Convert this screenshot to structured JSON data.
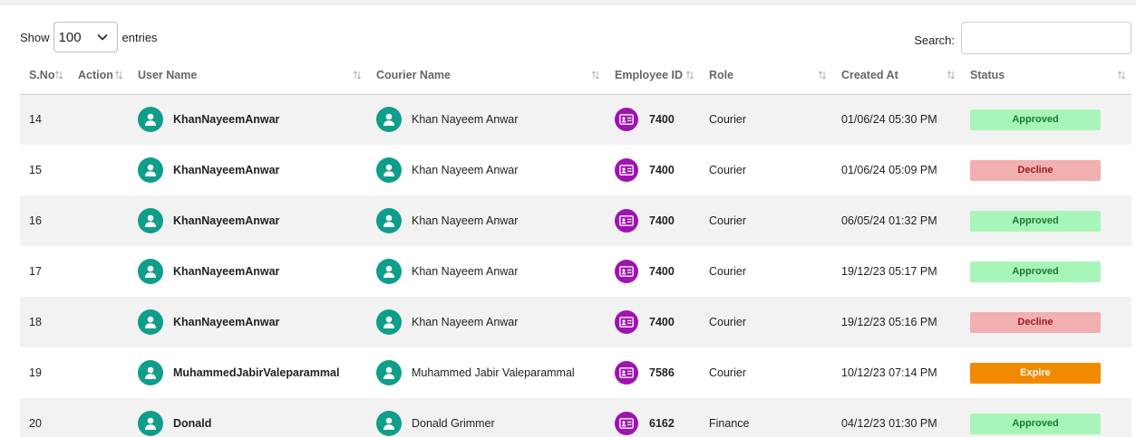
{
  "controls": {
    "show_label": "Show",
    "entries_value": "100",
    "entries_label": "entries",
    "search_label": "Search:",
    "search_value": ""
  },
  "columns": [
    {
      "key": "sno",
      "label": "S.No"
    },
    {
      "key": "action",
      "label": "Action"
    },
    {
      "key": "user_name",
      "label": "User Name"
    },
    {
      "key": "courier_name",
      "label": "Courier Name"
    },
    {
      "key": "employee_id",
      "label": "Employee ID"
    },
    {
      "key": "role",
      "label": "Role"
    },
    {
      "key": "created_at",
      "label": "Created At"
    },
    {
      "key": "status",
      "label": "Status"
    }
  ],
  "rows": [
    {
      "sno": "14",
      "user_name": "KhanNayeemAnwar",
      "courier_name": "Khan Nayeem Anwar",
      "employee_id": "7400",
      "role": "Courier",
      "created_at": "01/06/24 05:30 PM",
      "status": "Approved",
      "status_type": "approved"
    },
    {
      "sno": "15",
      "user_name": "KhanNayeemAnwar",
      "courier_name": "Khan Nayeem Anwar",
      "employee_id": "7400",
      "role": "Courier",
      "created_at": "01/06/24 05:09 PM",
      "status": "Decline",
      "status_type": "decline"
    },
    {
      "sno": "16",
      "user_name": "KhanNayeemAnwar",
      "courier_name": "Khan Nayeem Anwar",
      "employee_id": "7400",
      "role": "Courier",
      "created_at": "06/05/24 01:32 PM",
      "status": "Approved",
      "status_type": "approved"
    },
    {
      "sno": "17",
      "user_name": "KhanNayeemAnwar",
      "courier_name": "Khan Nayeem Anwar",
      "employee_id": "7400",
      "role": "Courier",
      "created_at": "19/12/23 05:17 PM",
      "status": "Approved",
      "status_type": "approved"
    },
    {
      "sno": "18",
      "user_name": "KhanNayeemAnwar",
      "courier_name": "Khan Nayeem Anwar",
      "employee_id": "7400",
      "role": "Courier",
      "created_at": "19/12/23 05:16 PM",
      "status": "Decline",
      "status_type": "decline"
    },
    {
      "sno": "19",
      "user_name": "MuhammedJabirValeparammal",
      "courier_name": "Muhammed Jabir Valeparammal",
      "employee_id": "7586",
      "role": "Courier",
      "created_at": "10/12/23 07:14 PM",
      "status": "Expire",
      "status_type": "expire"
    },
    {
      "sno": "20",
      "user_name": "Donald",
      "courier_name": "Donald Grimmer",
      "employee_id": "6162",
      "role": "Finance",
      "created_at": "04/12/23 01:30 PM",
      "status": "Approved",
      "status_type": "approved"
    }
  ],
  "icons": {
    "avatar": "user-icon",
    "employee_id": "id-card-icon",
    "sort": "sort-arrows-icon",
    "dropdown": "chevron-down-icon"
  },
  "colors": {
    "avatar_bg": "#0e9e8b",
    "id_icon_bg": "#a012b2",
    "approved_bg": "#a8f5b9",
    "decline_bg": "#f2afb0",
    "expire_bg": "#f28a00"
  }
}
